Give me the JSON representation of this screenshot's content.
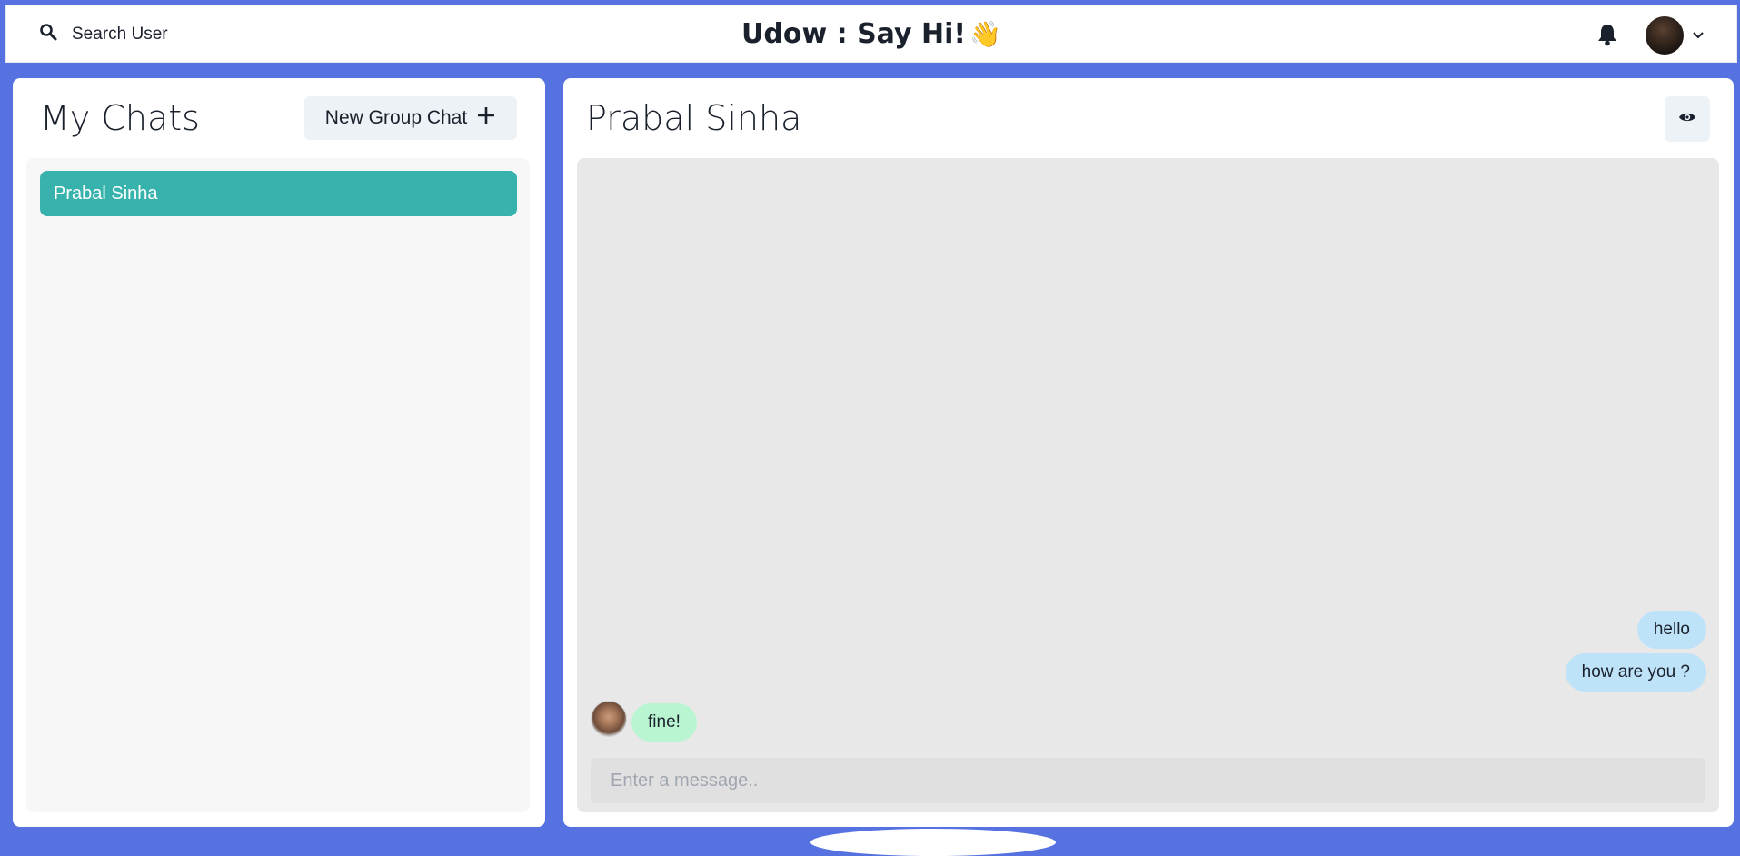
{
  "header": {
    "search_label": "Search User",
    "app_title": "Udow : Say Hi!",
    "wave_emoji": "👋"
  },
  "sidebar": {
    "title": "My Chats",
    "new_group_label": "New Group Chat",
    "chats": [
      {
        "name": "Prabal Sinha",
        "selected": true
      }
    ]
  },
  "chat": {
    "title": "Prabal Sinha",
    "messages": [
      {
        "text": "hello",
        "from": "me"
      },
      {
        "text": "how are you ?",
        "from": "me"
      },
      {
        "text": "fine!",
        "from": "other"
      }
    ],
    "input_placeholder": "Enter a message.."
  },
  "colors": {
    "background": "#5672e0",
    "chat_selected": "#38b2ac",
    "sent_bubble": "#bee3f8",
    "received_bubble": "#b9f5d0"
  },
  "icons": [
    "search-icon",
    "bell-icon",
    "chevron-down-icon",
    "plus-icon",
    "eye-icon"
  ]
}
